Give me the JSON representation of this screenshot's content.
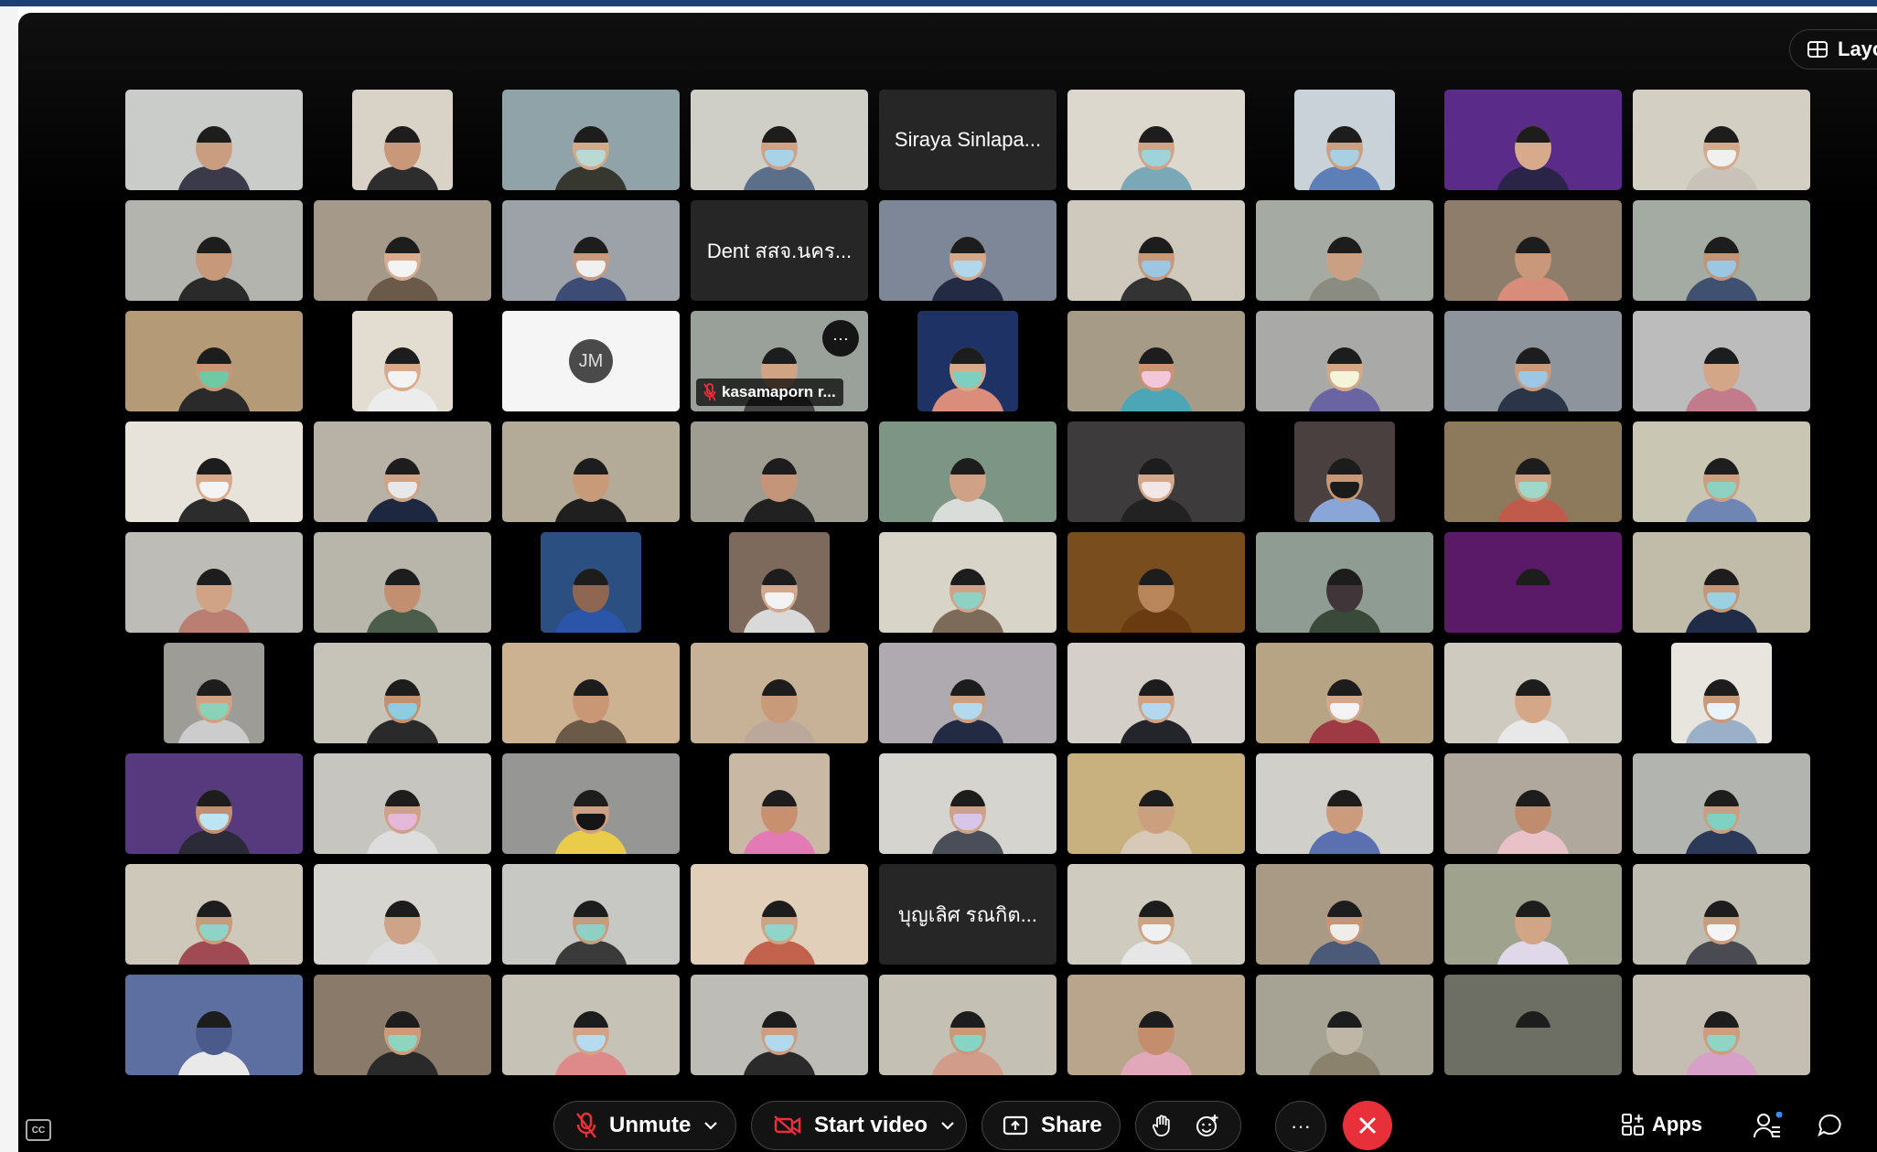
{
  "window": {
    "layout_label": "Layout"
  },
  "tiles": [
    {
      "type": "video",
      "bg": "#c9ccc8",
      "skin": "#c99d7f",
      "mask": "",
      "shirt": "#3a3a4a"
    },
    {
      "type": "video",
      "narrow": true,
      "bg": "#d9d2c6",
      "skin": "#c99779",
      "mask": "",
      "shirt": "#2d2d2d"
    },
    {
      "type": "video",
      "bg": "#8fa3a8",
      "skin": "#d4a988",
      "mask": "#b9d9d2",
      "shirt": "#36382f"
    },
    {
      "type": "video",
      "bg": "#cfcfc8",
      "skin": "#d0a184",
      "mask": "#a8d2e6",
      "shirt": "#5b6f8a"
    },
    {
      "type": "name",
      "name": "Siraya Sinlapa..."
    },
    {
      "type": "video",
      "bg": "#ddd8ce",
      "skin": "#d2a486",
      "mask": "#9fd3d9",
      "shirt": "#7aa8b8"
    },
    {
      "type": "video",
      "narrow": true,
      "bg": "#c9d2d8",
      "skin": "#cc9f80",
      "mask": "#a9d0e2",
      "shirt": "#5c7fb8"
    },
    {
      "type": "video",
      "bg": "#5b2b8a",
      "skin": "#d6aa8a",
      "mask": "",
      "shirt": "#2a2448"
    },
    {
      "type": "video",
      "bg": "#d3cfc3",
      "skin": "#d4a98b",
      "mask": "#f0f0f0",
      "shirt": "#c9c2b8"
    },
    {
      "type": "video",
      "bg": "#b3b4ae",
      "skin": "#c7987a",
      "mask": "",
      "shirt": "#2a2a2a"
    },
    {
      "type": "video",
      "bg": "#a59a8a",
      "skin": "#d8ad8f",
      "mask": "#f4f4f4",
      "shirt": "#6b5a4a"
    },
    {
      "type": "video",
      "bg": "#9da2a8",
      "skin": "#c69a7e",
      "mask": "#f0f0f0",
      "shirt": "#3c4c74"
    },
    {
      "type": "name",
      "name": "Dent สสจ.นคร..."
    },
    {
      "type": "video",
      "bg": "#7e8798",
      "skin": "#d4a78a",
      "mask": "#b1d7ec",
      "shirt": "#222a44"
    },
    {
      "type": "video",
      "bg": "#cfc8bc",
      "skin": "#c9987a",
      "mask": "#9bc7e3",
      "shirt": "#333"
    },
    {
      "type": "video",
      "bg": "#a5aba3",
      "skin": "#c9a083",
      "mask": "",
      "shirt": "#8a8c82"
    },
    {
      "type": "video",
      "bg": "#8e7d6b",
      "skin": "#c9987a",
      "mask": "",
      "shirt": "#d88d7a"
    },
    {
      "type": "video",
      "bg": "#a3aba2",
      "skin": "#c39578",
      "mask": "#9bc7e3",
      "shirt": "#3f5070"
    },
    {
      "type": "video",
      "bg": "#b49a76",
      "skin": "#c99777",
      "mask": "#6fc9a4",
      "shirt": "#2a2a2a"
    },
    {
      "type": "video",
      "narrow": true,
      "bg": "#e3ddd1",
      "skin": "#d8ab8c",
      "mask": "#f3f3f3",
      "shirt": "#ececec"
    },
    {
      "type": "initials",
      "initials": "JM"
    },
    {
      "type": "video",
      "bg": "#9aa19a",
      "skin": "#cfa485",
      "mask": "",
      "shirt": "#444",
      "chip": "kasamaporn r...",
      "more": true
    },
    {
      "type": "video",
      "narrow": true,
      "bg": "#1f3266",
      "skin": "#d7aa8b",
      "mask": "#7fcfc0",
      "shirt": "#d98d7a"
    },
    {
      "type": "video",
      "bg": "#a59b86",
      "skin": "#c99474",
      "mask": "#f1c7d9",
      "shirt": "#4ca6b5"
    },
    {
      "type": "video",
      "bg": "#a9aaa7",
      "skin": "#d3a889",
      "mask": "#f4f4d8",
      "shirt": "#6a64a2"
    },
    {
      "type": "video",
      "bg": "#8d949c",
      "skin": "#c99a7c",
      "mask": "#9cc8e6",
      "shirt": "#2a3548"
    },
    {
      "type": "video",
      "bg": "#bcbcbc",
      "skin": "#d2a687",
      "mask": "",
      "shirt": "#c27b8a"
    },
    {
      "type": "video",
      "bg": "#e7e3db",
      "skin": "#d6aa8b",
      "mask": "#f4f4f4",
      "shirt": "#2c2c2c"
    },
    {
      "type": "video",
      "bg": "#b8b2a6",
      "skin": "#cfa386",
      "mask": "#e8e8e8",
      "shirt": "#1d2840"
    },
    {
      "type": "video",
      "bg": "#b4aa98",
      "skin": "#c99a7a",
      "mask": "",
      "shirt": "#1f1f1f"
    },
    {
      "type": "video",
      "bg": "#9f9c92",
      "skin": "#c5957a",
      "mask": "",
      "shirt": "#212121"
    },
    {
      "type": "video",
      "bg": "#7d9584",
      "skin": "#cfa287",
      "mask": "",
      "shirt": "#d9ddd9"
    },
    {
      "type": "video",
      "bg": "#3d3b3b",
      "skin": "#d3a78a",
      "mask": "#f2e6e6",
      "shirt": "#222"
    },
    {
      "type": "video",
      "narrow": true,
      "bg": "#4a4040",
      "skin": "#c79878",
      "mask": "#1b1b1b",
      "shirt": "#8aa6d8"
    },
    {
      "type": "video",
      "bg": "#8d7a5d",
      "skin": "#cca083",
      "mask": "#9fd8c8",
      "shirt": "#c05a4a"
    },
    {
      "type": "video",
      "bg": "#c9c6b3",
      "skin": "#cd9f80",
      "mask": "#8fd1c0",
      "shirt": "#6f86b5"
    },
    {
      "type": "video",
      "bg": "#bdbcb6",
      "skin": "#d0a386",
      "mask": "",
      "shirt": "#ba7f72"
    },
    {
      "type": "video",
      "bg": "#b8b5ab",
      "skin": "#c38f71",
      "mask": "",
      "shirt": "#4c5d4c"
    },
    {
      "type": "video",
      "narrow": true,
      "bg": "#2c4f82",
      "skin": "#8e6652",
      "mask": "",
      "shirt": "#2a55a8"
    },
    {
      "type": "video",
      "narrow": true,
      "bg": "#7d6a5c",
      "skin": "#d4a88b",
      "mask": "#f3f3f3",
      "shirt": "#d9d9d9"
    },
    {
      "type": "video",
      "bg": "#d9d4c8",
      "skin": "#d0a388",
      "mask": "#8ed2c4",
      "shirt": "#7d6b5a"
    },
    {
      "type": "video",
      "bg": "#7a4d1f",
      "skin": "#b8865a",
      "mask": "",
      "shirt": "#6a3a10"
    },
    {
      "type": "video",
      "bg": "#8e9c94",
      "skin": "#40363a",
      "mask": "",
      "shirt": "#3a4a3a"
    },
    {
      "type": "video",
      "bg": "#5b1a68",
      "skin": "#5b1a68",
      "mask": "",
      "shirt": "#5b1a68"
    },
    {
      "type": "video",
      "bg": "#c0bca9",
      "skin": "#c69776",
      "mask": "#9ad0e0",
      "shirt": "#202c48"
    },
    {
      "type": "video",
      "narrow": true,
      "bg": "#9d9c96",
      "skin": "#d0a183",
      "mask": "#88d3b8",
      "shirt": "#ccc"
    },
    {
      "type": "video",
      "bg": "#c6c3b8",
      "skin": "#c3916f",
      "mask": "#8ecce0",
      "shirt": "#2a2a2a"
    },
    {
      "type": "video",
      "bg": "#cdb292",
      "skin": "#c99676",
      "mask": "",
      "shirt": "#6b5a48"
    },
    {
      "type": "video",
      "bg": "#c7b297",
      "skin": "#c99a7a",
      "mask": "",
      "shirt": "#bba89a"
    },
    {
      "type": "video",
      "bg": "#aeaab0",
      "skin": "#cba083",
      "mask": "#b3d9ee",
      "shirt": "#222a44"
    },
    {
      "type": "video",
      "bg": "#d4d0c9",
      "skin": "#d0a385",
      "mask": "#b4d7ee",
      "shirt": "#24242b"
    },
    {
      "type": "video",
      "bg": "#b7a484",
      "skin": "#d4a88a",
      "mask": "#f3f3f3",
      "shirt": "#9e3a44"
    },
    {
      "type": "video",
      "bg": "#cfcac0",
      "skin": "#d3a788",
      "mask": "",
      "shirt": "#e8e8e8"
    },
    {
      "type": "video",
      "narrow": true,
      "bg": "#e8e4de",
      "skin": "#c99a7a",
      "mask": "#eaf2fa",
      "shirt": "#9ab0c8"
    },
    {
      "type": "video",
      "bg": "#573a7e",
      "skin": "#c48f6e",
      "mask": "#bde4f2",
      "shirt": "#2a2a38"
    },
    {
      "type": "video",
      "bg": "#c7c5bf",
      "skin": "#cfa185",
      "mask": "#e5b7d8",
      "shirt": "#ddd"
    },
    {
      "type": "video",
      "bg": "#969695",
      "skin": "#cf9f7f",
      "mask": "#151515",
      "shirt": "#e8cc4a"
    },
    {
      "type": "video",
      "narrow": true,
      "bg": "#c9b9a4",
      "skin": "#c99070",
      "mask": "",
      "shirt": "#e47ab5"
    },
    {
      "type": "video",
      "bg": "#d6d4ce",
      "skin": "#cfa185",
      "mask": "#d8c6e8",
      "shirt": "#4a4e58"
    },
    {
      "type": "video",
      "bg": "#c9b17f",
      "skin": "#cca07e",
      "mask": "",
      "shirt": "#d8c8b8"
    },
    {
      "type": "video",
      "bg": "#d0cfca",
      "skin": "#cb9b7c",
      "mask": "",
      "shirt": "#5a70b0"
    },
    {
      "type": "video",
      "bg": "#b1a89d",
      "skin": "#c08c6e",
      "mask": "",
      "shirt": "#e8c2c8"
    },
    {
      "type": "video",
      "bg": "#b2b5af",
      "skin": "#cc9e80",
      "mask": "#7fd1c4",
      "shirt": "#2c3a5a"
    },
    {
      "type": "video",
      "bg": "#cdc8b9",
      "skin": "#cb9a7b",
      "mask": "#8fd3c7",
      "shirt": "#a24a54"
    },
    {
      "type": "video",
      "bg": "#d7d5cf",
      "skin": "#cfa387",
      "mask": "",
      "shirt": "#ddd"
    },
    {
      "type": "video",
      "bg": "#c7c8c3",
      "skin": "#c99b7b",
      "mask": "#8ed1c3",
      "shirt": "#3a3a3a"
    },
    {
      "type": "video",
      "bg": "#e2cfba",
      "skin": "#d1a183",
      "mask": "#8fd6c8",
      "shirt": "#c2624d"
    },
    {
      "type": "name",
      "name": "บุญเลิศ รณกิต..."
    },
    {
      "type": "video",
      "bg": "#cfcbbf",
      "skin": "#cfa284",
      "mask": "#f0f0f0",
      "shirt": "#e6e6e6"
    },
    {
      "type": "video",
      "bg": "#a99a86",
      "skin": "#c99576",
      "mask": "#f0ece8",
      "shirt": "#4a5a78"
    },
    {
      "type": "video",
      "bg": "#9fa38e",
      "skin": "#d2a587",
      "mask": "",
      "shirt": "#ded8e8"
    },
    {
      "type": "video",
      "bg": "#bfbcb2",
      "skin": "#cb9d7f",
      "mask": "#f4f4f4",
      "shirt": "#4a4a52"
    },
    {
      "type": "video",
      "bg": "#5c6fa0",
      "skin": "#4a5a8a",
      "mask": "",
      "shirt": "#e9e9e9"
    },
    {
      "type": "video",
      "bg": "#8a7a6a",
      "skin": "#cd9b7c",
      "mask": "#8ed4be",
      "shirt": "#2a2a2a"
    },
    {
      "type": "video",
      "bg": "#c6c2b6",
      "skin": "#d0a386",
      "mask": "#b6dbef",
      "shirt": "#de8a8a"
    },
    {
      "type": "video",
      "bg": "#bebcb7",
      "skin": "#cd9f80",
      "mask": "#b0d9ee",
      "shirt": "#2a2a2a"
    },
    {
      "type": "video",
      "bg": "#c4c0b4",
      "skin": "#c99979",
      "mask": "#88d4c4",
      "shirt": "#d29c8a"
    },
    {
      "type": "video",
      "bg": "#b8a58c",
      "skin": "#c48e6e",
      "mask": "",
      "shirt": "#e0a8b8"
    },
    {
      "type": "video",
      "bg": "#a7a394",
      "skin": "#bfb6a6",
      "mask": "",
      "shirt": "#8a826c"
    },
    {
      "type": "video",
      "bg": "#6d6e64",
      "skin": "#6d6e64",
      "mask": "",
      "shirt": "#6d6e64"
    },
    {
      "type": "video",
      "bg": "#c3bdb2",
      "skin": "#cc9d7e",
      "mask": "#8fd4c4",
      "shirt": "#d6a0c8"
    }
  ],
  "controls": {
    "unmute_label": "Unmute",
    "start_video_label": "Start video",
    "share_label": "Share",
    "more_label": "···",
    "apps_label": "Apps",
    "cc_label": "CC",
    "end_color": "#e8303a",
    "notification_dot_color": "#3a8cf0"
  }
}
